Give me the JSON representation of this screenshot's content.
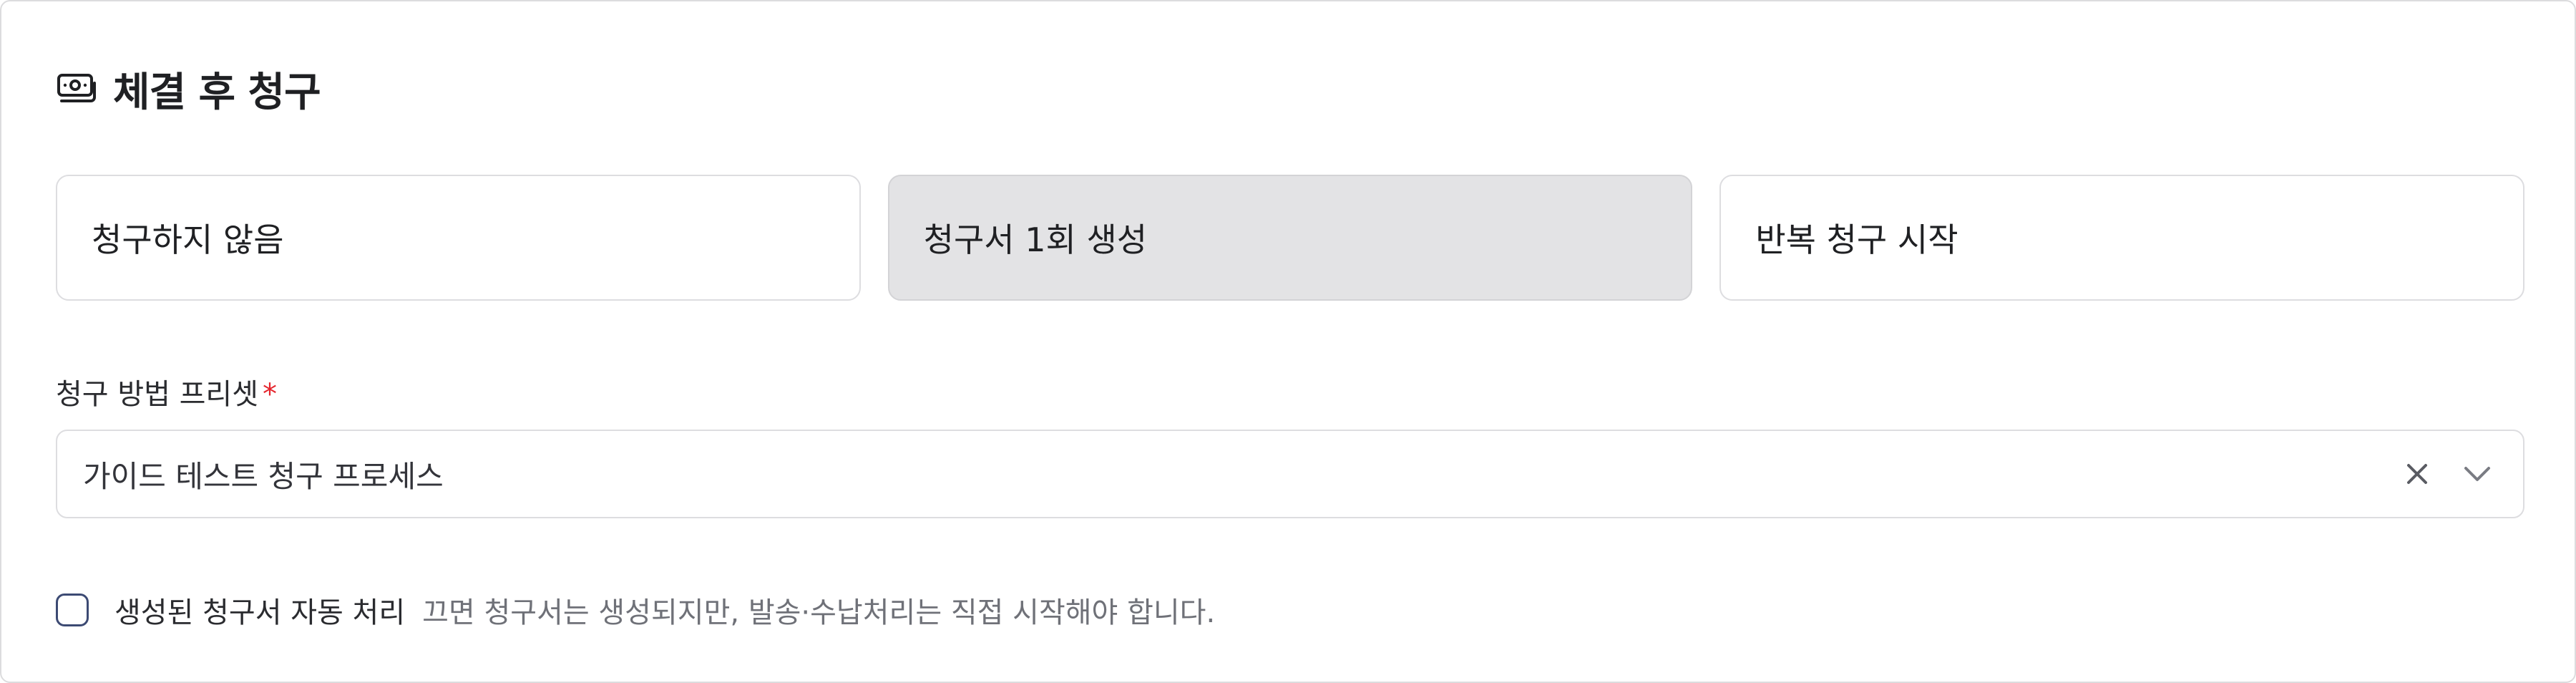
{
  "header": {
    "icon": "money-bill-icon",
    "title": "체결 후 청구"
  },
  "options": [
    {
      "label": "청구하지 않음",
      "selected": false
    },
    {
      "label": "청구서 1회 생성",
      "selected": true
    },
    {
      "label": "반복 청구 시작",
      "selected": false
    }
  ],
  "preset_field": {
    "label": "청구 방법 프리셋",
    "required_mark": "*",
    "value": "가이드 테스트 청구 프로세스",
    "clear_icon": "close-icon",
    "dropdown_icon": "chevron-down-icon"
  },
  "auto_process": {
    "checked": false,
    "label": "생성된 청구서 자동 처리",
    "help": "끄면 청구서는 생성되지만, 발송·수납처리는 직접 시작해야 합니다."
  },
  "colors": {
    "selected_option_bg": "#e3e3e5",
    "required": "#e5262e",
    "checkbox_border": "#3c4a73"
  }
}
